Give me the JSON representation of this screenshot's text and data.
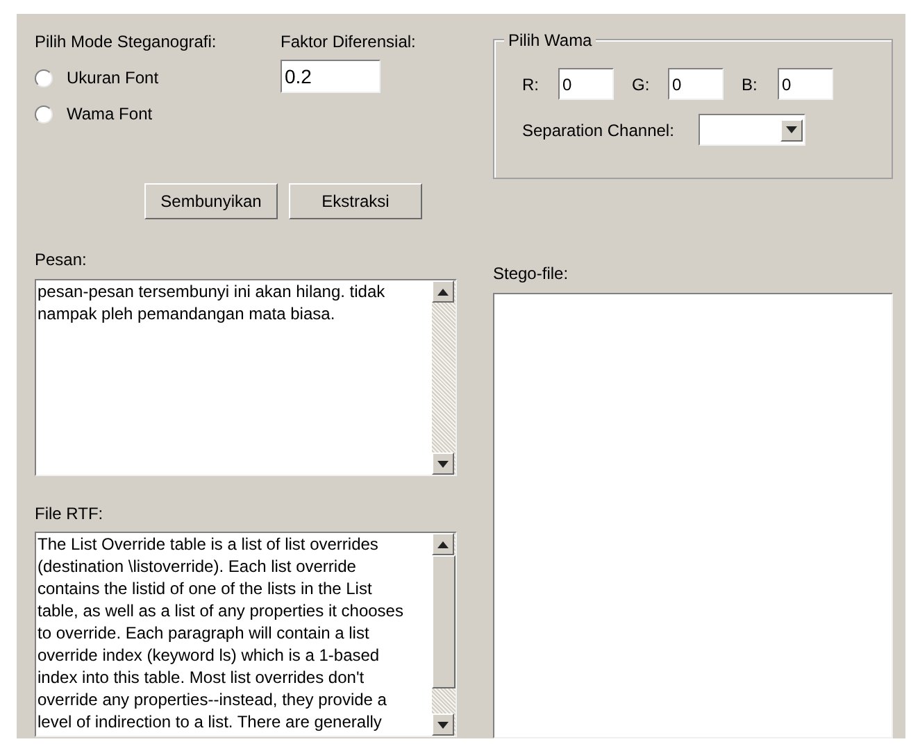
{
  "mode": {
    "label": "Pilih Mode Steganografi:",
    "options": [
      {
        "label": "Ukuran Font",
        "selected": false
      },
      {
        "label": "Wama Font",
        "selected": false
      }
    ]
  },
  "factor": {
    "label": "Faktor Diferensial:",
    "value": "0.2"
  },
  "color_group": {
    "title": "Pilih Wama",
    "channels": [
      {
        "label": "R:",
        "value": "0"
      },
      {
        "label": "G:",
        "value": "0"
      },
      {
        "label": "B:",
        "value": "0"
      }
    ],
    "separation": {
      "label": "Separation Channel:"
    }
  },
  "buttons": [
    "Sembunyikan",
    "Ekstraksi"
  ],
  "message": {
    "label": "Pesan:",
    "lines": [
      "pesan-pesan tersembunyi ini akan hilang. tidak",
      "nampak pleh pemandangan mata biasa."
    ]
  },
  "rtf": {
    "label": "File RTF:",
    "lines": [
      "The List Override table is a list of list overrides",
      "(destination \\listoverride). Each list override",
      "contains the listid of one of the lists in the List",
      "table, as well as a list of any properties it chooses",
      "to override. Each paragraph will contain a list",
      "override index (keyword ls) which is a 1-based",
      "index into this table. Most list overrides don't",
      "override any properties--instead, they provide a",
      "level of indirection to a list. There are generally"
    ]
  },
  "stego": {
    "label": "Stego-file:"
  }
}
